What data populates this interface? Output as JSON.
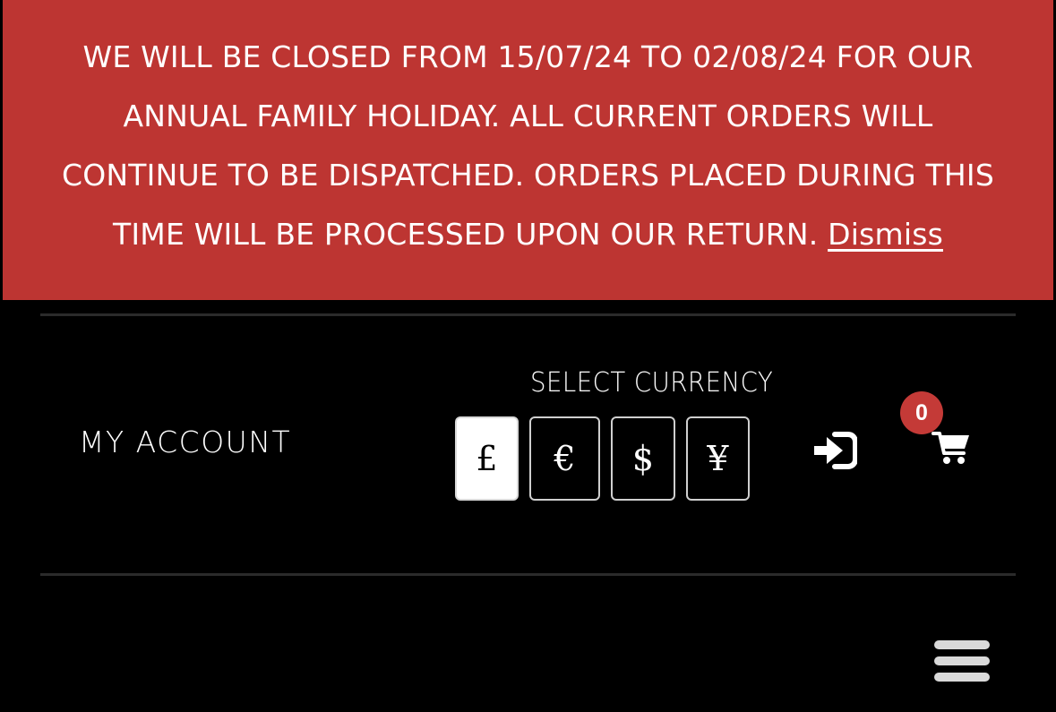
{
  "notice": {
    "lines": [
      "WE WILL BE CLOSED FROM 15/07/24 TO 02/08/24 FOR OUR",
      "ANNUAL FAMILY HOLIDAY. ALL CURRENT ORDERS WILL",
      "CONTINUE TO BE DISPATCHED. ORDERS PLACED DURING THIS",
      "TIME WILL BE PROCESSED UPON OUR RETURN."
    ],
    "dismiss_label": "Dismiss",
    "background_color": "#bd3532"
  },
  "header": {
    "my_account_label": "MY ACCOUNT",
    "currency": {
      "label": "SELECT CURRENCY",
      "options": [
        "£",
        "€",
        "$",
        "¥"
      ],
      "selected": "£"
    },
    "login_icon": "sign-in-icon",
    "cart": {
      "icon": "shopping-cart-icon",
      "count": "0"
    },
    "menu_icon": "hamburger-menu-icon"
  }
}
